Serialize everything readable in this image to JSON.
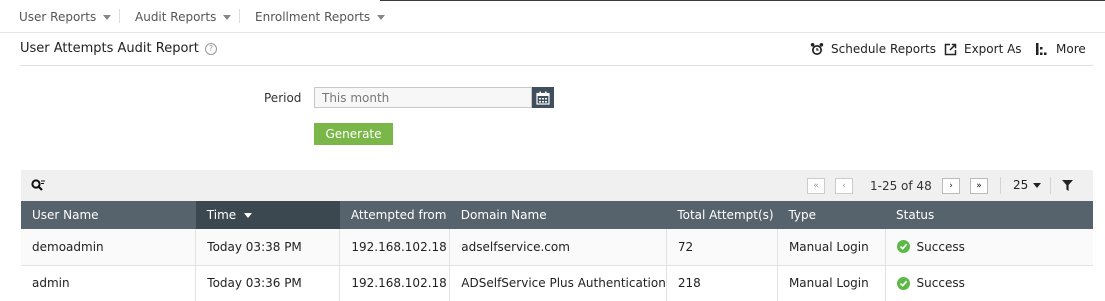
{
  "nav": {
    "items": [
      {
        "label": "User Reports"
      },
      {
        "label": "Audit Reports"
      },
      {
        "label": "Enrollment Reports"
      }
    ]
  },
  "header": {
    "title": "User Attempts Audit Report",
    "help_glyph": "?",
    "actions": {
      "schedule": "Schedule Reports",
      "export": "Export As",
      "more": "More"
    }
  },
  "form": {
    "period_label": "Period",
    "period_value": "This month",
    "generate_label": "Generate"
  },
  "toolbar": {
    "first_glyph": "«",
    "prev_glyph": "‹",
    "next_glyph": "›",
    "last_glyph": "»",
    "range": "1-25 of 48",
    "per_page": "25"
  },
  "table": {
    "columns": [
      "User Name",
      "Time",
      "Attempted from",
      "Domain Name",
      "Total Attempt(s)",
      "Type",
      "Status"
    ],
    "sorted_column": "Time",
    "rows": [
      {
        "user": "demoadmin",
        "time": "Today 03:38 PM",
        "from": "192.168.102.18",
        "domain": "adselfservice.com",
        "attempts": "72",
        "type": "Manual Login",
        "status": "Success"
      },
      {
        "user": "admin",
        "time": "Today 03:36 PM",
        "from": "192.168.102.18",
        "domain": "ADSelfService Plus Authentication",
        "attempts": "218",
        "type": "Manual Login",
        "status": "Success"
      }
    ]
  },
  "colors": {
    "header_bg": "#56636c",
    "sorted_header_bg": "#3c4850",
    "generate_bg": "#7ab648",
    "success": "#5cb947"
  }
}
